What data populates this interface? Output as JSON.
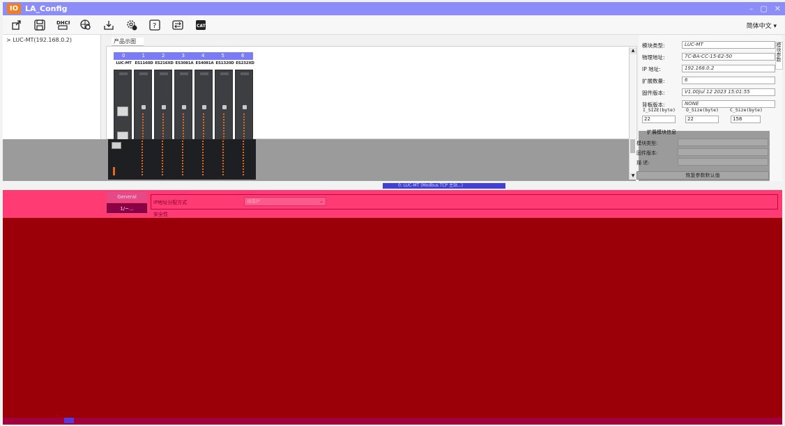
{
  "window": {
    "title": "LA_Config",
    "logo_text": "IO",
    "controls": [
      "–",
      "▢",
      "✕"
    ]
  },
  "toolbar": {
    "icons": [
      "upload-icon",
      "save-icon",
      "dhcp-icon",
      "network-scan-icon",
      "download-icon",
      "settings-icon",
      "help-icon",
      "compare-icon",
      "cat-icon"
    ],
    "dhcp_label": "DHCP",
    "language": "简体中文 ▾"
  },
  "tree": {
    "items": [
      "> LUC-MT(192.168.0.2)"
    ]
  },
  "graph": {
    "tab_label": "产品示图",
    "slots": [
      "0",
      "1",
      "2",
      "3",
      "4",
      "5",
      "6"
    ],
    "modules": [
      "LUC-MT",
      "ES1160D",
      "ES216XD",
      "ES3081A",
      "ES4081A",
      "ES1320D",
      "ES232XD"
    ],
    "status_text": "0: LUC-MT (Modbus TCP 主站...)"
  },
  "properties": {
    "side_tab": "模块参数",
    "rows": [
      {
        "label": "模块类型:",
        "value": "LUC-MT"
      },
      {
        "label": "物理地址:",
        "value": "7C-BA-CC-15-E2-50"
      },
      {
        "label": "IP 地址:",
        "value": "192.168.0.2"
      },
      {
        "label": "扩展数量:",
        "value": "6"
      },
      {
        "label": "固件版本:",
        "value": "V1.00Jul 12 2023 15:01:55"
      },
      {
        "label": "背板版本:",
        "value": "NONE"
      }
    ],
    "size_headers": [
      "I_SIZE(byte)",
      "O_Size(byte)",
      "C_Size(byte)"
    ],
    "size_values": [
      "22",
      "22",
      "158"
    ],
    "group_title": "扩展模块信息",
    "group_rows": [
      "模块类型:",
      "固件版本:",
      "描    述:"
    ],
    "restore_button": "恢复参数默认值"
  },
  "config": {
    "side_tabs": [
      "General",
      "1/~..."
    ],
    "ip_label": "IP地址分配方式",
    "ip_value": "动态IP",
    "security_label": "安全性"
  },
  "colors": {
    "titlebar": "#8d8dfa",
    "slotbar": "#7b7bf6",
    "pink_band": "#ff3b73",
    "dark_red": "#9b0008"
  }
}
